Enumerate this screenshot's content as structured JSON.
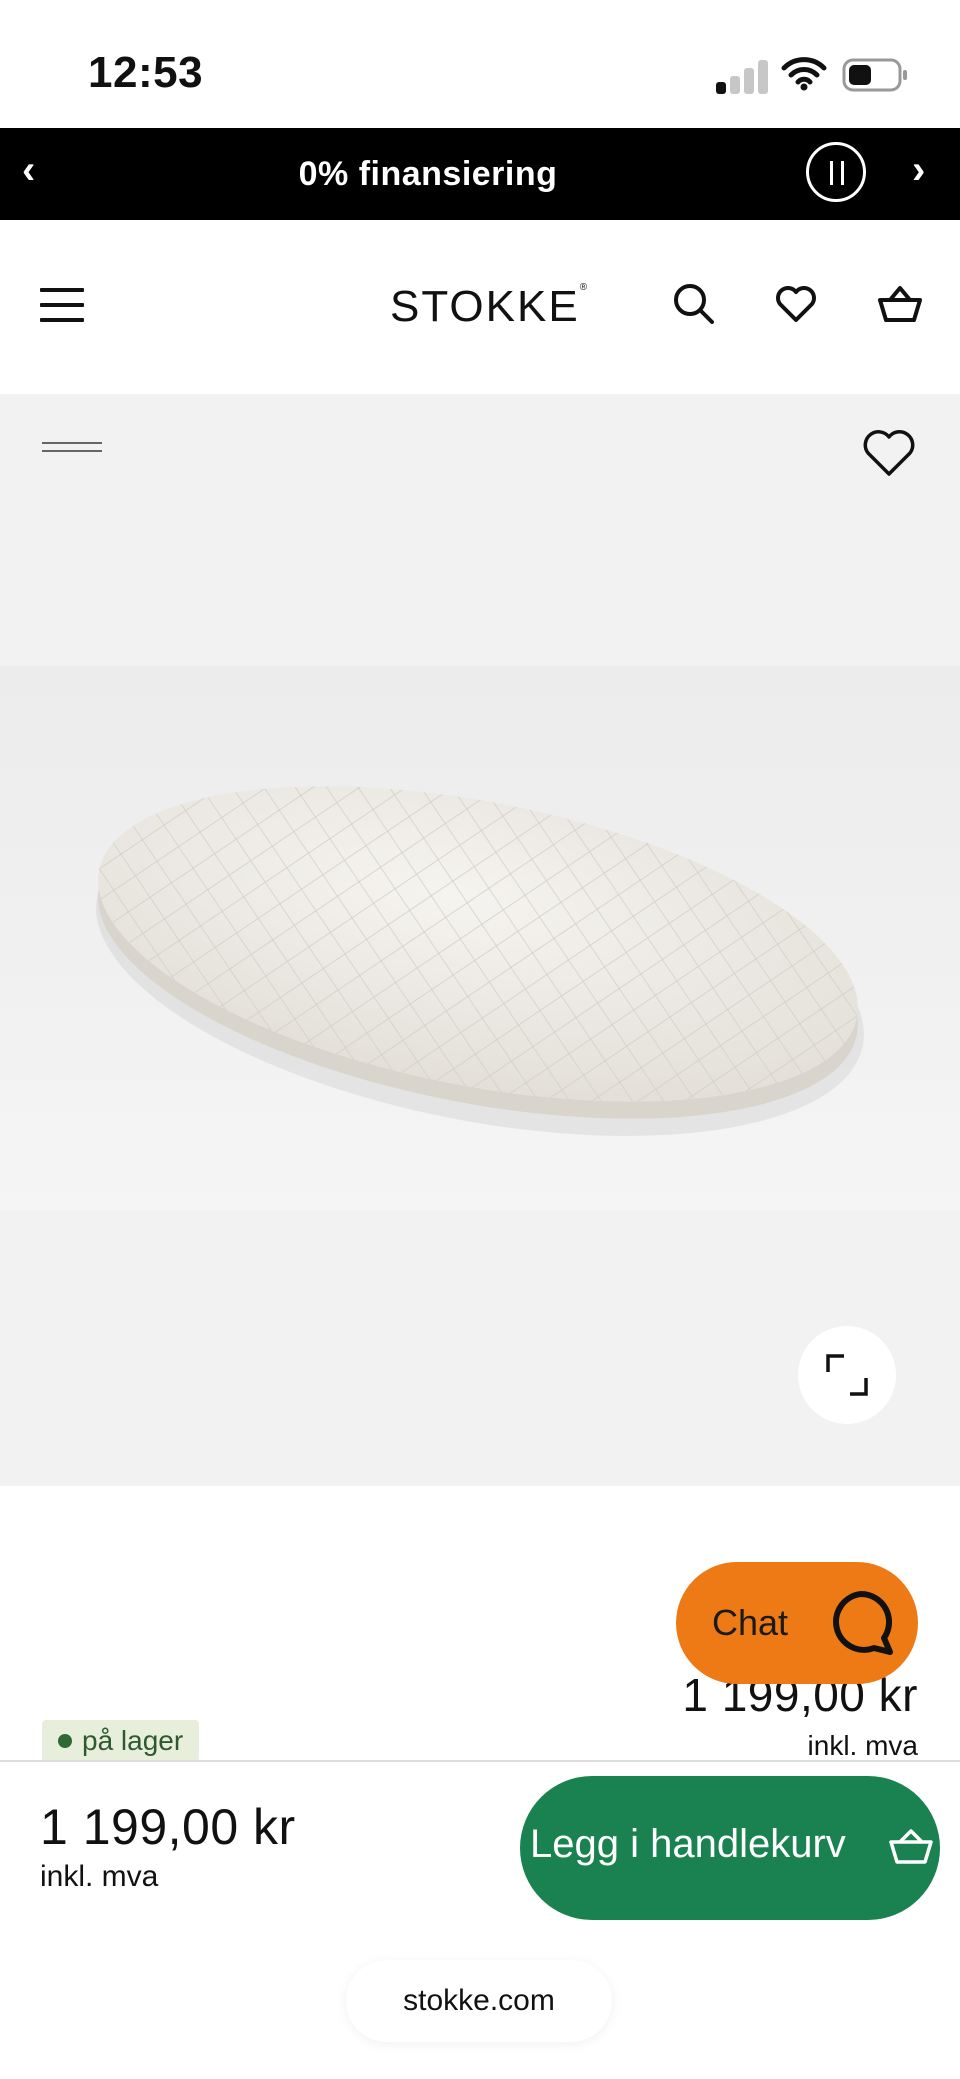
{
  "status_bar": {
    "time": "12:53"
  },
  "announcement": {
    "text": "0% finansiering",
    "prev_glyph": "‹",
    "next_glyph": "›"
  },
  "header": {
    "logo": "STOKKE",
    "logo_mark": "®",
    "icons": [
      "menu-icon",
      "search-icon",
      "heart-icon",
      "basket-icon"
    ]
  },
  "gallery": {
    "image_alt": "mattress-image",
    "icons": [
      "heart-icon",
      "expand-icon"
    ]
  },
  "product": {
    "price": "1 199,00 kr",
    "vat_note": "inkl. mva",
    "stock_status": "på lager"
  },
  "chat": {
    "label": "Chat"
  },
  "sticky_bar": {
    "price": "1 199,00 kr",
    "vat_note": "inkl. mva",
    "add_to_cart_label": "Legg i handlekurv"
  },
  "browser": {
    "domain": "stokke.com"
  },
  "colors": {
    "announcement_bg": "#000000",
    "chat_orange": "#ed7a14",
    "cta_green": "#1a8250",
    "stock_badge_bg": "#e8eedc",
    "stock_dot": "#2f6a34"
  }
}
